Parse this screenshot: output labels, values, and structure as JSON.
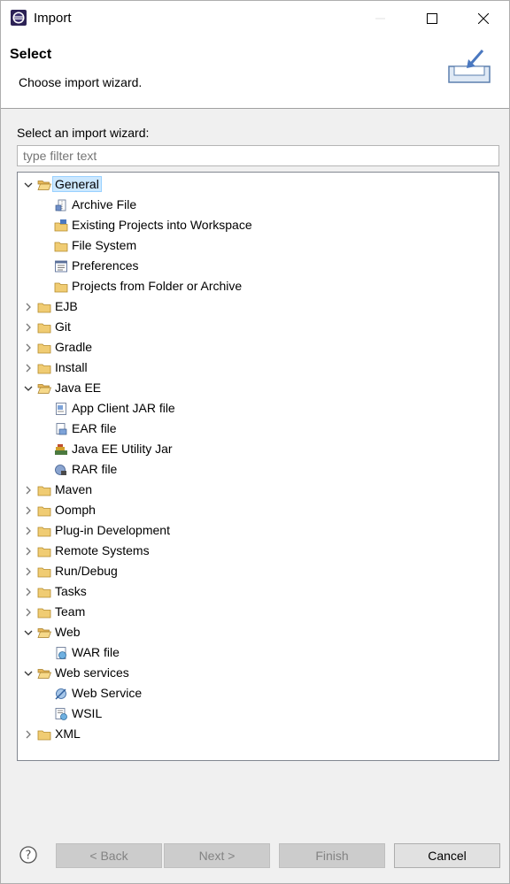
{
  "window": {
    "title": "Import"
  },
  "header": {
    "title": "Select",
    "description": "Choose import wizard."
  },
  "filter": {
    "label": "Select an import wizard:",
    "placeholder": "type filter text",
    "value": ""
  },
  "tree": [
    {
      "label": "General",
      "level": 0,
      "expanded": true,
      "selected": true,
      "icon": "folder-open-icon"
    },
    {
      "label": "Archive File",
      "level": 1,
      "icon": "archive-file-icon"
    },
    {
      "label": "Existing Projects into Workspace",
      "level": 1,
      "icon": "existing-projects-icon"
    },
    {
      "label": "File System",
      "level": 1,
      "icon": "folder-icon"
    },
    {
      "label": "Preferences",
      "level": 1,
      "icon": "preferences-icon"
    },
    {
      "label": "Projects from Folder or Archive",
      "level": 1,
      "icon": "folder-icon"
    },
    {
      "label": "EJB",
      "level": 0,
      "expanded": false,
      "icon": "folder-icon"
    },
    {
      "label": "Git",
      "level": 0,
      "expanded": false,
      "icon": "folder-icon"
    },
    {
      "label": "Gradle",
      "level": 0,
      "expanded": false,
      "icon": "folder-icon"
    },
    {
      "label": "Install",
      "level": 0,
      "expanded": false,
      "icon": "folder-icon"
    },
    {
      "label": "Java EE",
      "level": 0,
      "expanded": true,
      "icon": "folder-open-icon"
    },
    {
      "label": "App Client JAR file",
      "level": 1,
      "icon": "app-client-jar-icon"
    },
    {
      "label": "EAR file",
      "level": 1,
      "icon": "ear-file-icon"
    },
    {
      "label": "Java EE Utility Jar",
      "level": 1,
      "icon": "utility-jar-icon"
    },
    {
      "label": "RAR file",
      "level": 1,
      "icon": "rar-file-icon"
    },
    {
      "label": "Maven",
      "level": 0,
      "expanded": false,
      "icon": "folder-icon"
    },
    {
      "label": "Oomph",
      "level": 0,
      "expanded": false,
      "icon": "folder-icon"
    },
    {
      "label": "Plug-in Development",
      "level": 0,
      "expanded": false,
      "icon": "folder-icon"
    },
    {
      "label": "Remote Systems",
      "level": 0,
      "expanded": false,
      "icon": "folder-icon"
    },
    {
      "label": "Run/Debug",
      "level": 0,
      "expanded": false,
      "icon": "folder-icon"
    },
    {
      "label": "Tasks",
      "level": 0,
      "expanded": false,
      "icon": "folder-icon"
    },
    {
      "label": "Team",
      "level": 0,
      "expanded": false,
      "icon": "folder-icon"
    },
    {
      "label": "Web",
      "level": 0,
      "expanded": true,
      "icon": "folder-open-icon"
    },
    {
      "label": "WAR file",
      "level": 1,
      "icon": "war-file-icon"
    },
    {
      "label": "Web services",
      "level": 0,
      "expanded": true,
      "icon": "folder-open-icon"
    },
    {
      "label": "Web Service",
      "level": 1,
      "icon": "web-service-icon"
    },
    {
      "label": "WSIL",
      "level": 1,
      "icon": "wsil-icon"
    },
    {
      "label": "XML",
      "level": 0,
      "expanded": false,
      "icon": "folder-icon"
    }
  ],
  "buttons": {
    "back": "< Back",
    "next": "Next >",
    "finish": "Finish",
    "cancel": "Cancel"
  },
  "colors": {
    "selection": "#cce8ff",
    "folder": "#e8c16b"
  }
}
